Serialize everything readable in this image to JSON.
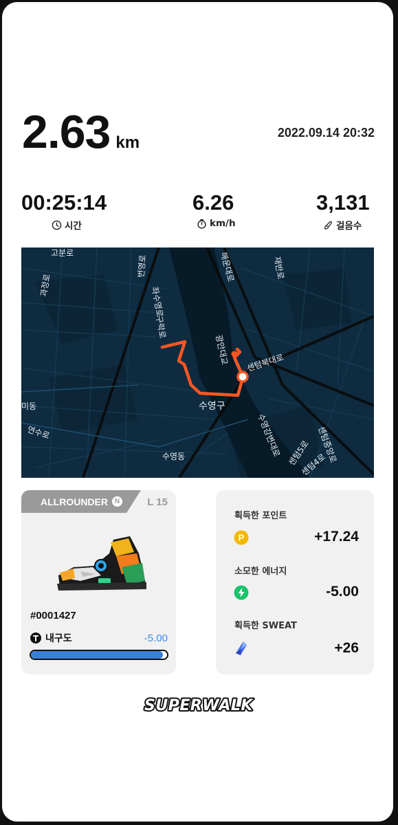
{
  "summary": {
    "distance": "2.63",
    "distance_unit": "km",
    "datetime": "2022.09.14 20:32"
  },
  "stats": [
    {
      "value": "00:25:14",
      "label": "시간",
      "icon": "clock-icon"
    },
    {
      "value": "6.26",
      "label": "km/h",
      "icon": "stopwatch-icon"
    },
    {
      "value": "3,131",
      "label": "걸음수",
      "icon": "shoe-print-icon"
    }
  ],
  "map": {
    "labels": [
      "고분로",
      "과정로",
      "번영로",
      "좌수영로",
      "구락로",
      "광안대교",
      "해운대로",
      "재반로",
      "센텀북대로",
      "수영구",
      "미동",
      "연수로",
      "수영동",
      "수영강변대로",
      "센텀5로",
      "센텀4로",
      "센텀중앙로"
    ],
    "colors": {
      "water": "#081d2c",
      "land": "#0e2b40",
      "route": "#ff5722"
    }
  },
  "shoe": {
    "class": "ALLROUNDER",
    "class_badge": "N",
    "level": "L 15",
    "id": "#0001427",
    "durability_label": "내구도",
    "durability_delta": "-5.00",
    "durability_fill": 0.97
  },
  "rewards": [
    {
      "label": "획득한 포인트",
      "value": "+17.24",
      "icon": "point-coin-icon"
    },
    {
      "label": "소모한 에너지",
      "value": "-5.00",
      "icon": "energy-bolt-icon"
    },
    {
      "label": "획득한 SWEAT",
      "value": "+26",
      "icon": "sweat-crystal-icon"
    }
  ],
  "brand": "SUPERWALK"
}
